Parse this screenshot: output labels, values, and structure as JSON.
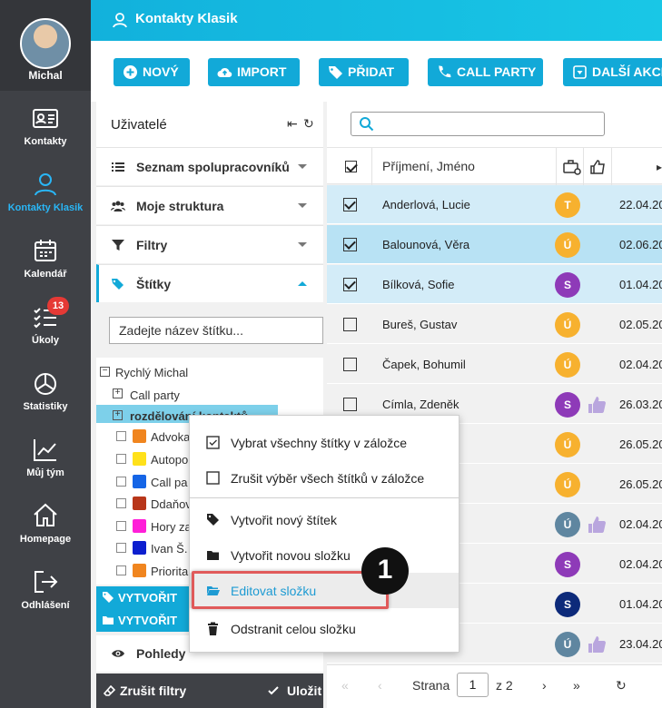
{
  "user": {
    "name": "Michal"
  },
  "nav": [
    {
      "id": "kontakty",
      "label": "Kontakty",
      "icon": "id-card-icon"
    },
    {
      "id": "kontakty-klasik",
      "label": "Kontakty Klasik",
      "icon": "person-icon",
      "active": true
    },
    {
      "id": "kalendar",
      "label": "Kalendář",
      "icon": "calendar-icon"
    },
    {
      "id": "ukoly",
      "label": "Úkoly",
      "icon": "checklist-icon",
      "badge": "13"
    },
    {
      "id": "statistiky",
      "label": "Statistiky",
      "icon": "pie-chart-icon"
    },
    {
      "id": "muj-tym",
      "label": "Můj tým",
      "icon": "trend-chart-icon"
    },
    {
      "id": "homepage",
      "label": "Homepage",
      "icon": "home-icon"
    },
    {
      "id": "odhlaseni",
      "label": "Odhlášení",
      "icon": "logout-icon"
    }
  ],
  "header": {
    "title": "Kontakty Klasik"
  },
  "toolbar": {
    "buttons": [
      {
        "label": "NOVÝ",
        "icon": "plus-circle-icon"
      },
      {
        "label": "IMPORT",
        "icon": "cloud-upload-icon"
      },
      {
        "label": "PŘIDAT",
        "icon": "tags-icon"
      },
      {
        "label": "CALL PARTY",
        "icon": "phone-icon"
      },
      {
        "label": "DALŠÍ AKCE",
        "icon": "caret-box-icon"
      }
    ]
  },
  "panel": {
    "title": "Uživatelé",
    "accordion": [
      {
        "label": "Seznam spolupracovníků",
        "icon": "list-icon"
      },
      {
        "label": "Moje struktura",
        "icon": "users-icon"
      },
      {
        "label": "Filtry",
        "icon": "filter-icon"
      },
      {
        "label": "Štítky",
        "icon": "tags-icon",
        "active": true
      }
    ],
    "tag_input_placeholder": "Zadejte název štítku...",
    "tree": {
      "root": "Rychlý Michal",
      "folders": [
        "Call party",
        "rozdělování kontaktů"
      ],
      "tags": [
        {
          "label": "Advoka",
          "color": "#f0851f"
        },
        {
          "label": "Autopo",
          "color": "#ffe11a"
        },
        {
          "label": "Call pa",
          "color": "#1565e6"
        },
        {
          "label": "Ddaňov",
          "color": "#b8361a"
        },
        {
          "label": "Hory za",
          "color": "#ff1fd8"
        },
        {
          "label": "Ivan Š.",
          "color": "#0d1fcf"
        },
        {
          "label": "Priorita",
          "color": "#f0851f"
        }
      ]
    },
    "create_tag_label": "VYTVOŘIT",
    "create_folder_label": "VYTVOŘIT",
    "pohledy_label": "Pohledy",
    "footer": {
      "clear_label": "Zrušit filtry",
      "save_label": "Uložit"
    }
  },
  "grid": {
    "column_name": "Příjmení, Jméno",
    "rows": [
      {
        "name": "Anderlová, Lucie",
        "initial": "T",
        "avatar_color": "#f7b12f",
        "date": "22.04.20",
        "checked": true,
        "thumb": false
      },
      {
        "name": "Balounová, Věra",
        "initial": "Ú",
        "avatar_color": "#f7b12f",
        "date": "02.06.20",
        "checked": true,
        "thumb": false
      },
      {
        "name": "Bílková, Sofie",
        "initial": "S",
        "avatar_color": "#8e3ab8",
        "date": "01.04.20",
        "checked": true,
        "thumb": false
      },
      {
        "name": "Bureš, Gustav",
        "initial": "Ú",
        "avatar_color": "#f7b12f",
        "date": "02.05.20",
        "checked": false,
        "thumb": false
      },
      {
        "name": "Čapek, Bohumil",
        "initial": "Ú",
        "avatar_color": "#f7b12f",
        "date": "02.04.20",
        "checked": false,
        "thumb": false
      },
      {
        "name": "Címla, Zdeněk",
        "initial": "S",
        "avatar_color": "#8e3ab8",
        "date": "26.03.20",
        "checked": false,
        "thumb": true
      },
      {
        "name": "",
        "initial": "Ú",
        "avatar_color": "#f7b12f",
        "date": "26.05.20",
        "checked": false,
        "thumb": false
      },
      {
        "name": "",
        "initial": "Ú",
        "avatar_color": "#f7b12f",
        "date": "26.05.20",
        "checked": false,
        "thumb": false
      },
      {
        "name": "",
        "initial": "Ú",
        "avatar_color": "#5f86a0",
        "date": "02.04.20",
        "checked": false,
        "thumb": true
      },
      {
        "name": "",
        "initial": "S",
        "avatar_color": "#8e3ab8",
        "date": "02.04.20",
        "checked": false,
        "thumb": false
      },
      {
        "name": "",
        "initial": "S",
        "avatar_color": "#0d2a7a",
        "date": "01.04.20",
        "checked": false,
        "thumb": false
      },
      {
        "name": "",
        "initial": "Ú",
        "avatar_color": "#5f86a0",
        "date": "23.04.20",
        "checked": false,
        "thumb": true
      }
    ],
    "pager": {
      "label": "Strana",
      "page": "1",
      "of": "z 2"
    }
  },
  "context_menu": {
    "items": [
      {
        "label": "Vybrat všechny štítky v záložce",
        "icon": "checkbox-checked-icon"
      },
      {
        "label": "Zrušit výběr všech štítků v záložce",
        "icon": "checkbox-empty-icon"
      },
      {
        "label": "Vytvořit nový štítek",
        "icon": "tag-icon"
      },
      {
        "label": "Vytvořit novou složku",
        "icon": "folder-icon"
      },
      {
        "label": "Editovat složku",
        "icon": "folder-open-icon",
        "highlighted": true
      },
      {
        "label": "Odstranit celou složku",
        "icon": "trash-icon"
      }
    ]
  },
  "annotation": {
    "marker": "1"
  },
  "colors": {
    "accent": "#12a9d8",
    "nav_bg": "#3f4146",
    "highlight_text": "#1e9bd3",
    "callout": "#e05a5a"
  }
}
